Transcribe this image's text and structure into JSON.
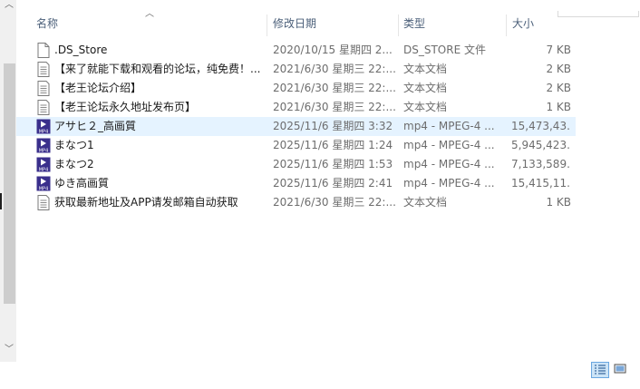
{
  "columns": {
    "name": "名称",
    "date": "修改日期",
    "type": "类型",
    "size": "大小"
  },
  "files": [
    {
      "name": ".DS_Store",
      "date": "2020/10/15 星期四 2...",
      "type": "DS_STORE 文件",
      "size": "7 KB",
      "icon": "document-icon"
    },
    {
      "name": "【来了就能下载和观看的论坛，纯免费！...",
      "date": "2021/6/30 星期三 22:...",
      "type": "文本文档",
      "size": "2 KB",
      "icon": "text-document-icon"
    },
    {
      "name": "【老王论坛介绍】",
      "date": "2021/6/30 星期三 22:...",
      "type": "文本文档",
      "size": "2 KB",
      "icon": "text-document-icon"
    },
    {
      "name": "【老王论坛永久地址发布页】",
      "date": "2021/6/30 星期三 22:...",
      "type": "文本文档",
      "size": "1 KB",
      "icon": "text-document-icon"
    },
    {
      "name": "アサヒ２_高画質",
      "date": "2025/11/6 星期四 3:32",
      "type": "mp4 - MPEG-4 ...",
      "size": "15,473,43...",
      "icon": "mp4-video-icon"
    },
    {
      "name": "まなつ1",
      "date": "2025/11/6 星期四 1:24",
      "type": "mp4 - MPEG-4 ...",
      "size": "5,945,423...",
      "icon": "mp4-video-icon"
    },
    {
      "name": "まなつ2",
      "date": "2025/11/6 星期四 1:53",
      "type": "mp4 - MPEG-4 ...",
      "size": "7,133,589...",
      "icon": "mp4-video-icon"
    },
    {
      "name": "ゆき高画質",
      "date": "2025/11/6 星期四 2:41",
      "type": "mp4 - MPEG-4 ...",
      "size": "15,415,11...",
      "icon": "mp4-video-icon"
    },
    {
      "name": "获取最新地址及APP请发邮箱自动获取",
      "date": "2021/6/30 星期三 22:...",
      "type": "文本文档",
      "size": "1 KB",
      "icon": "text-document-icon"
    }
  ],
  "selected_row": 4,
  "colors": {
    "selection": "#e5f3ff",
    "header_text": "#4c607a",
    "mp4_badge": "#3a2f8c"
  }
}
